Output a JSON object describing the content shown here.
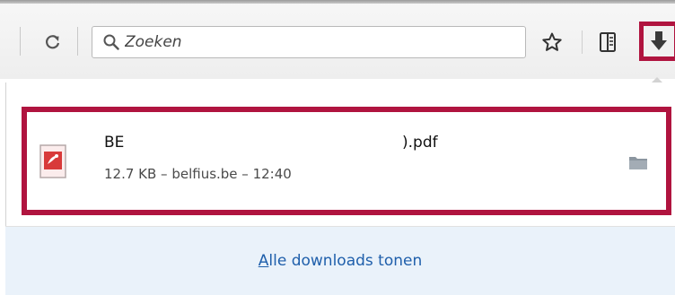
{
  "toolbar": {
    "search_placeholder": "Zoeken",
    "icons": [
      "reload-icon",
      "search-icon",
      "star-icon",
      "reading-list-icon",
      "download-arrow-icon"
    ],
    "highlight_color": "#b0143f"
  },
  "download": {
    "file_name_start": "BE",
    "file_name_end": ").pdf",
    "meta": "12.7 KB – belfius.be – 12:40",
    "icons": [
      "pdf-file-icon",
      "folder-icon"
    ]
  },
  "footer": {
    "link_accesskey": "A",
    "link_rest": "lle downloads tonen",
    "link_color": "#1f5fab",
    "background": "#eaf2fa"
  }
}
